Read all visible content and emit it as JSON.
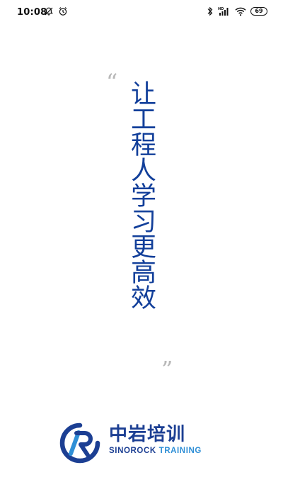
{
  "status_bar": {
    "time": "10:08",
    "battery_level": "69",
    "icons_left": [
      "notifications-off-icon",
      "alarm-icon"
    ],
    "icons_right": [
      "bluetooth-icon",
      "hd-signal-icon",
      "wifi-icon",
      "battery-icon"
    ]
  },
  "slogan": {
    "open_quote": "“",
    "text": "让工程人学习更高效",
    "close_quote": "”"
  },
  "logo": {
    "chinese_name": "中岩培训",
    "english_name_part1": "SINOROCK",
    "english_name_part2": "TRAINING",
    "colors": {
      "primary": "#1c3f93",
      "accent": "#2f8fd6"
    }
  }
}
